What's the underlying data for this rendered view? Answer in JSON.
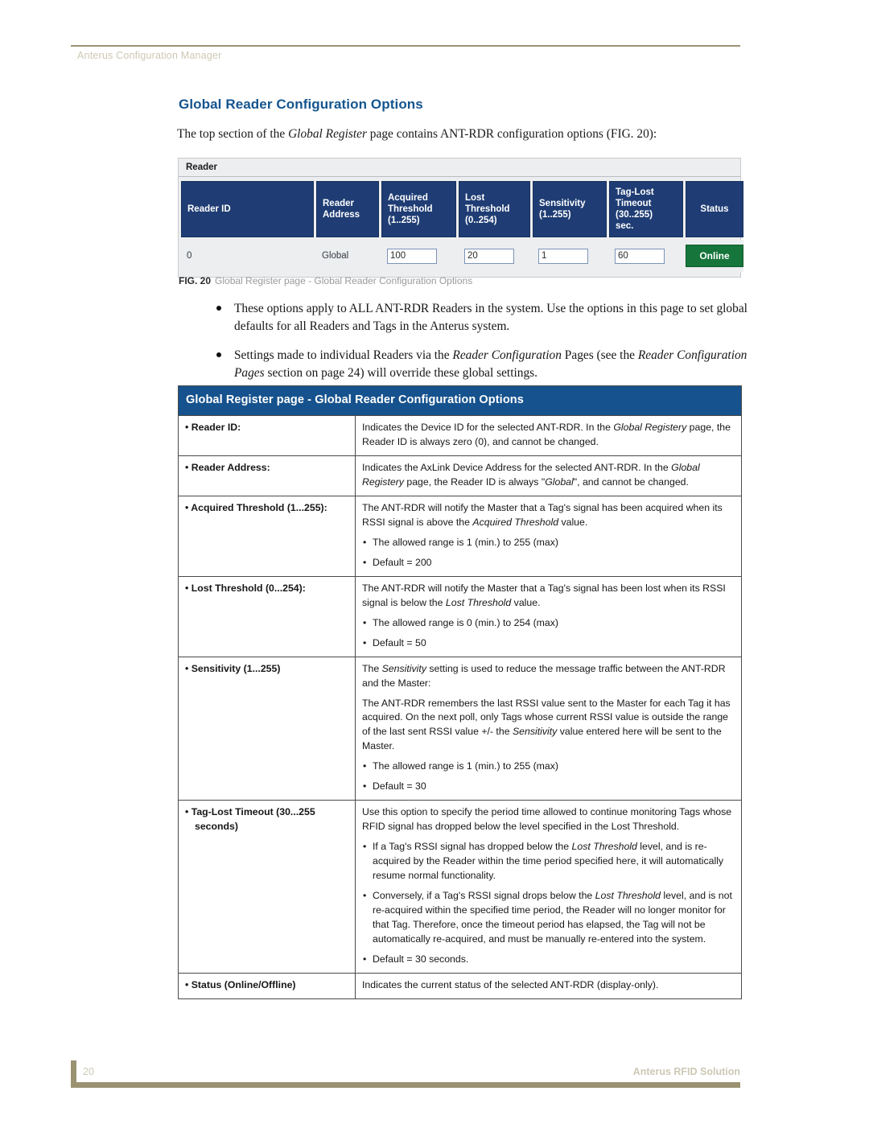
{
  "header": {
    "running_title": "Anterus Configuration Manager"
  },
  "section": {
    "heading": "Global Reader Configuration Options",
    "intro_before": "The top section of the ",
    "intro_italic": "Global Register",
    "intro_after": " page contains ANT-RDR configuration options (FIG. 20):"
  },
  "figure": {
    "panel_title": "Reader",
    "columns": [
      "Reader ID",
      "Reader Address",
      "Acquired Threshold (1..255)",
      "Lost Threshold (0..254)",
      "Sensitivity (1..255)",
      "Tag-Lost Timeout (30..255) sec.",
      "Status"
    ],
    "col_lines": {
      "reader_id": [
        "Reader ID"
      ],
      "reader_address": [
        "Reader",
        "Address"
      ],
      "acquired_threshold": [
        "Acquired",
        "Threshold",
        "(1..255)"
      ],
      "lost_threshold": [
        "Lost",
        "Threshold",
        "(0..254)"
      ],
      "sensitivity": [
        "Sensitivity",
        "(1..255)"
      ],
      "tag_lost_timeout": [
        "Tag-Lost",
        "Timeout",
        "(30..255)",
        "sec."
      ],
      "status": [
        "Status"
      ]
    },
    "row": {
      "reader_id": "0",
      "reader_address": "Global",
      "acquired_threshold": "100",
      "lost_threshold": "20",
      "sensitivity": "1",
      "tag_lost_timeout": "60",
      "status": "Online"
    },
    "caption_label": "FIG. 20",
    "caption_text": "Global Register page - Global Reader Configuration Options",
    "status_color": "#16753a",
    "header_color": "#1f3d74"
  },
  "bullets": [
    {
      "parts": [
        {
          "t": "These options apply to ALL ANT-RDR Readers in the system. Use the options in this page to set global defaults for all Readers and Tags in the Anterus system.",
          "i": false
        }
      ]
    },
    {
      "parts": [
        {
          "t": "Settings made to individual Readers via the ",
          "i": false
        },
        {
          "t": "Reader Configuration",
          "i": true
        },
        {
          "t": " Pages (see the ",
          "i": false
        },
        {
          "t": "Reader Configuration Pages",
          "i": true
        },
        {
          "t": " section on page 24) will override these global settings.",
          "i": false
        }
      ]
    }
  ],
  "desc_table": {
    "title": "Global Register page - Global Reader Configuration Options",
    "accent": "#16528d",
    "rows": [
      {
        "term": "• Reader ID:",
        "term_cont": "",
        "blocks": [
          {
            "type": "p",
            "parts": [
              {
                "t": "Indicates the Device ID for the selected ANT-RDR. In the ",
                "i": false
              },
              {
                "t": "Global Registery",
                "i": true
              },
              {
                "t": " page, the Reader ID is always zero (0), and cannot be changed.",
                "i": false
              }
            ]
          }
        ]
      },
      {
        "term": "• Reader Address:",
        "term_cont": "",
        "blocks": [
          {
            "type": "p",
            "parts": [
              {
                "t": "Indicates the AxLink Device Address for the selected ANT-RDR. In the ",
                "i": false
              },
              {
                "t": "Global Registery",
                "i": true
              },
              {
                "t": " page, the Reader ID is always \"",
                "i": false
              },
              {
                "t": "Global",
                "i": true
              },
              {
                "t": "\", and cannot be changed.",
                "i": false
              }
            ]
          }
        ]
      },
      {
        "term": "• Acquired Threshold (1...255):",
        "term_cont": "",
        "blocks": [
          {
            "type": "p",
            "parts": [
              {
                "t": "The ANT-RDR will notify the Master that a Tag's signal has been acquired when its RSSI signal is above the ",
                "i": false
              },
              {
                "t": "Acquired Threshold",
                "i": true
              },
              {
                "t": " value.",
                "i": false
              }
            ]
          },
          {
            "type": "sub",
            "parts": [
              {
                "t": "The allowed range is 1 (min.) to 255 (max)",
                "i": false
              }
            ]
          },
          {
            "type": "sub",
            "parts": [
              {
                "t": "Default = 200",
                "i": false
              }
            ]
          }
        ]
      },
      {
        "term": "• Lost Threshold (0...254):",
        "term_cont": "",
        "blocks": [
          {
            "type": "p",
            "parts": [
              {
                "t": "The ANT-RDR will notify the Master that a Tag's signal has been lost when its RSSI signal is below the ",
                "i": false
              },
              {
                "t": "Lost Threshold",
                "i": true
              },
              {
                "t": " value.",
                "i": false
              }
            ]
          },
          {
            "type": "sub",
            "parts": [
              {
                "t": "The allowed range is 0 (min.) to 254 (max)",
                "i": false
              }
            ]
          },
          {
            "type": "sub",
            "parts": [
              {
                "t": "Default = 50",
                "i": false
              }
            ]
          }
        ]
      },
      {
        "term": "• Sensitivity (1...255)",
        "term_cont": "",
        "blocks": [
          {
            "type": "p",
            "parts": [
              {
                "t": "The ",
                "i": false
              },
              {
                "t": "Sensitivity",
                "i": true
              },
              {
                "t": " setting is used to reduce the message traffic between the ANT-RDR and the Master:",
                "i": false
              }
            ]
          },
          {
            "type": "p",
            "parts": [
              {
                "t": "The ANT-RDR remembers the last RSSI value sent to the Master for each Tag it has acquired. On the next poll, only Tags whose current RSSI value is outside the range of the last sent RSSI value +/- the ",
                "i": false
              },
              {
                "t": "Sensitivity",
                "i": true
              },
              {
                "t": " value entered here will be sent to the Master.",
                "i": false
              }
            ]
          },
          {
            "type": "sub",
            "parts": [
              {
                "t": "The allowed range is 1 (min.) to 255 (max)",
                "i": false
              }
            ]
          },
          {
            "type": "sub",
            "parts": [
              {
                "t": "Default = 30",
                "i": false
              }
            ]
          }
        ]
      },
      {
        "term": "• Tag-Lost Timeout (30...255",
        "term_cont": "seconds)",
        "blocks": [
          {
            "type": "p",
            "parts": [
              {
                "t": "Use this option to specify the period time allowed to continue monitoring Tags whose RFID signal has dropped below the level specified in the Lost Threshold.",
                "i": false
              }
            ]
          },
          {
            "type": "sub",
            "parts": [
              {
                "t": "If a Tag's RSSI signal has dropped below the ",
                "i": false
              },
              {
                "t": "Lost Threshold",
                "i": true
              },
              {
                "t": " level, and is re-acquired by the Reader within the time period specified here, it will automatically resume normal functionality.",
                "i": false
              }
            ]
          },
          {
            "type": "sub",
            "parts": [
              {
                "t": "Conversely, if a Tag's RSSI signal drops below the ",
                "i": false
              },
              {
                "t": "Lost Threshold",
                "i": true
              },
              {
                "t": " level, and is not re-acquired within the specified time period, the Reader will no longer monitor for that Tag. Therefore, once the timeout period has elapsed, the Tag will not be automatically re-acquired, and must be manually re-entered into the system.",
                "i": false
              }
            ]
          },
          {
            "type": "sub",
            "parts": [
              {
                "t": "Default = 30 seconds.",
                "i": false
              }
            ]
          }
        ]
      },
      {
        "term": "• Status (Online/Offline)",
        "term_cont": "",
        "blocks": [
          {
            "type": "p",
            "parts": [
              {
                "t": "Indicates the current status of the selected ANT-RDR (display-only).",
                "i": false
              }
            ]
          }
        ]
      }
    ]
  },
  "footer": {
    "page_number": "20",
    "document_title": "Anterus RFID Solution"
  }
}
